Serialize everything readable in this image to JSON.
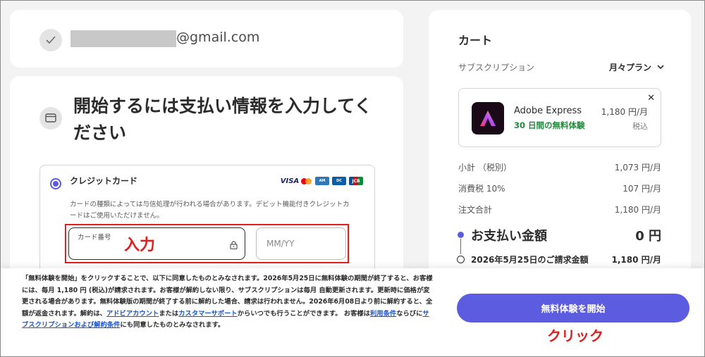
{
  "account": {
    "email_domain": "@gmail.com"
  },
  "payment": {
    "title": "開始するには支払い情報を入力してください",
    "method": {
      "label": "クレジットカード",
      "note": "カードの種類によっては与信処理が行われる場合があります。デビット機能付きクレジットカードはご使用いただけません。",
      "brands": [
        "VISA",
        "Mastercard",
        "AMEX",
        "Diners Club",
        "JCB"
      ],
      "card_number_label": "カード番号",
      "expiry_placeholder": "MM/YY"
    },
    "annotation_input": "入力"
  },
  "cart": {
    "title": "カート",
    "subscription_label": "サブスクリプション",
    "plan": "月々プラン",
    "product": {
      "name": "Adobe Express",
      "trial": "30 日間の無料体験",
      "price": "1,180 円/月",
      "tax_note": "税込"
    },
    "subtotal_label": "小計 （税別）",
    "subtotal_value": "1,073 円/月",
    "tax_label": "消費税 10%",
    "tax_value": "107 円/月",
    "total_label": "注文合計",
    "total_value": "1,180 円/月",
    "pay_label": "お支払い金額",
    "pay_amount": "0 円",
    "bill_label": "2026年5月25日のご請求金額",
    "bill_amount": "1,180 円/月"
  },
  "footer": {
    "terms_1": "「無料体験を開始」をクリックすることで、以下に同意したものとみなされます。2026年5月25日に無料体験の期間が終了すると、お客様には、毎月 1,180 円 (税込)が請求されます。お客様が解約しない限り、サブスクリプションは毎月 自動更新されます。更新時に価格が変更される場合があります。無料体験版の期間が終了する前に解約した場合、請求は行われません。2026年6月08日より前に解約すると、全額が返金されます。解約は、",
    "link_account": "アドビアカウント",
    "terms_2": "または",
    "link_support": "カスタマーサポート",
    "terms_3": "からいつでも行うことができます。 お客様は",
    "link_terms": "利用条件",
    "terms_4": "ならびに",
    "link_sub_terms": "サブスクリプションおよび解約条件",
    "terms_5": "にも同意したものとみなされます。",
    "cta_label": "無料体験を開始",
    "annotation_click": "クリック"
  },
  "colors": {
    "accent": "#5c5ce0",
    "annotation_red": "#e01e1e",
    "trial_green": "#1d8a3a",
    "link_blue": "#1a55c9"
  }
}
